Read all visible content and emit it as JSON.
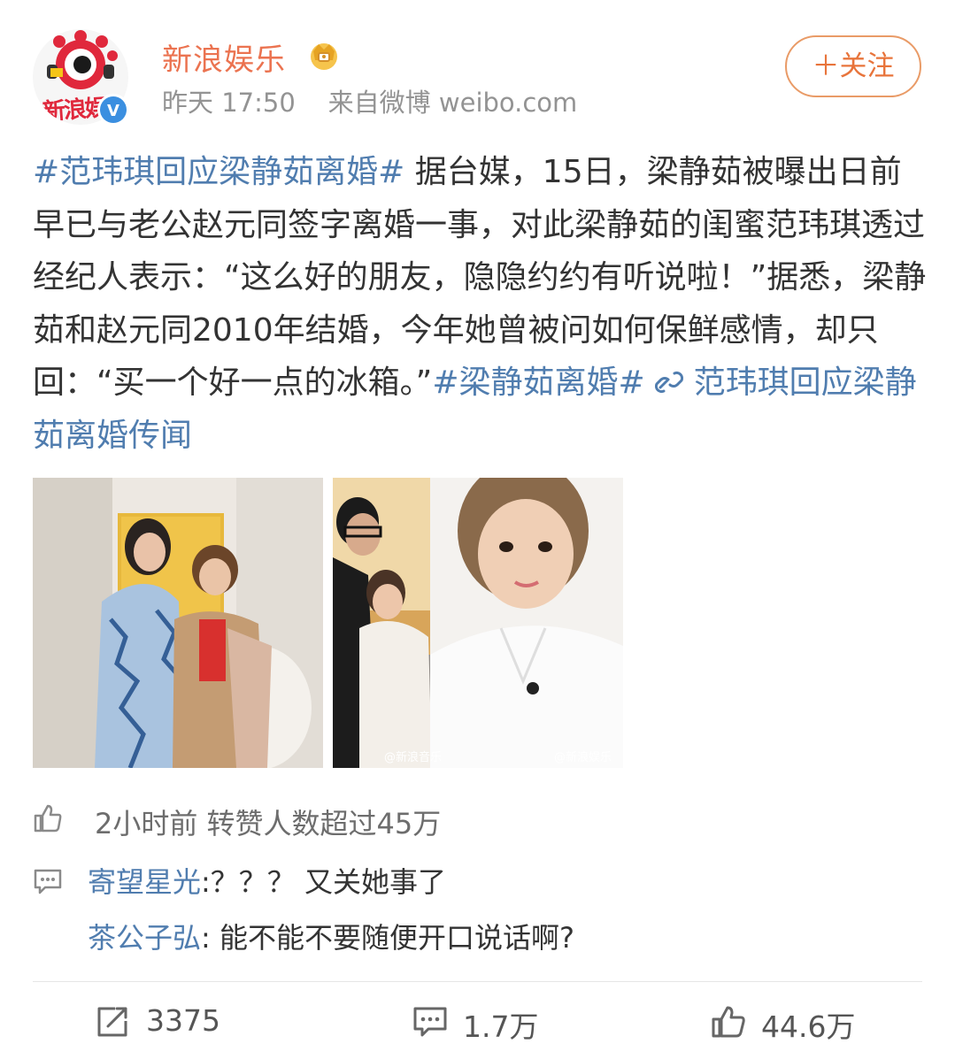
{
  "account": {
    "name": "新浪娱乐",
    "avatar_text": "新浪娱乐",
    "time": "昨天 17:50",
    "source": "来自微博 weibo.com"
  },
  "follow_button": {
    "label": "＋关注"
  },
  "post": {
    "topic1": "#范玮琪回应梁静茹离婚#",
    "body": " 据台媒，15日，梁静茹被曝出日前早已与老公赵元同签字离婚一事，对此梁静茹的闺蜜范玮琪透过经纪人表示：“这么好的朋友，隐隐约约有听说啦！”据悉，梁静茹和赵元同2010年结婚，今年她曾被问如何保鲜感情，却只回：“买一个好一点的冰箱。”",
    "topic2": "#梁静茹离婚#",
    "link_text": "范玮琪回应梁静茹离婚传闻"
  },
  "photos": [
    {
      "watermark": ""
    },
    {
      "watermark_left": "@新浪音乐",
      "watermark_right": "@新浪娱乐"
    }
  ],
  "likes_row": {
    "text": "2小时前 转赞人数超过45万"
  },
  "comments": [
    {
      "user": "寄望星光",
      "text": ":？？？ 又关她事了"
    },
    {
      "user": "茶公子弘",
      "text": ": 能不能不要随便开口说话啊?"
    }
  ],
  "footer": {
    "reposts": "3375",
    "comments": "1.7万",
    "likes": "44.6万"
  },
  "colors": {
    "link": "#507daf",
    "name": "#eb7350",
    "follow": "#e8743b",
    "meta": "#939393"
  },
  "icons": [
    "crown-icon",
    "verified-icon",
    "link-icon",
    "thumb-up-icon",
    "comment-icon",
    "repost-icon"
  ]
}
